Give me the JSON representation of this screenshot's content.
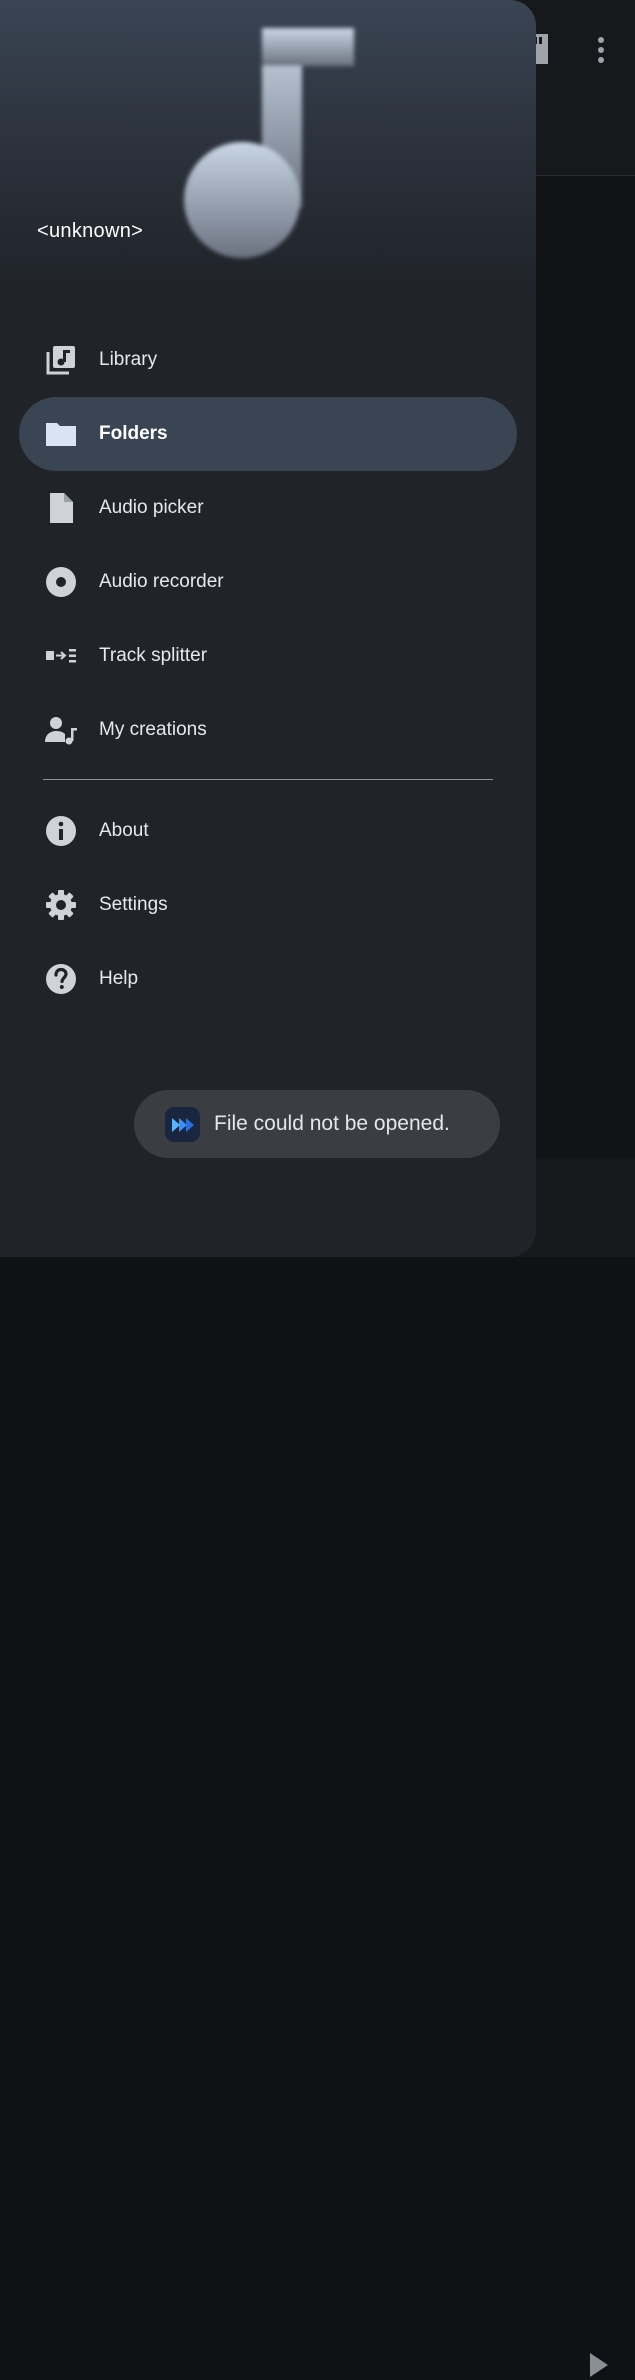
{
  "header": {
    "title": "<unknown>"
  },
  "nav": {
    "items": [
      {
        "label": "Library",
        "icon": "library-music-icon",
        "active": false
      },
      {
        "label": "Folders",
        "icon": "folder-icon",
        "active": true
      },
      {
        "label": "Audio picker",
        "icon": "file-icon",
        "active": false
      },
      {
        "label": "Audio recorder",
        "icon": "record-icon",
        "active": false
      },
      {
        "label": "Track splitter",
        "icon": "track-splitter-icon",
        "active": false
      },
      {
        "label": "My creations",
        "icon": "my-creations-icon",
        "active": false
      }
    ],
    "secondary": [
      {
        "label": "About",
        "icon": "info-icon"
      },
      {
        "label": "Settings",
        "icon": "gear-icon"
      },
      {
        "label": "Help",
        "icon": "help-icon"
      }
    ]
  },
  "toast": {
    "message": "File could not be opened.",
    "icon": "fast-forward-app-icon"
  },
  "colors": {
    "drawer_bg": "#202328",
    "active_item_bg": "#3a4554",
    "toast_bg": "#3a3d42"
  }
}
